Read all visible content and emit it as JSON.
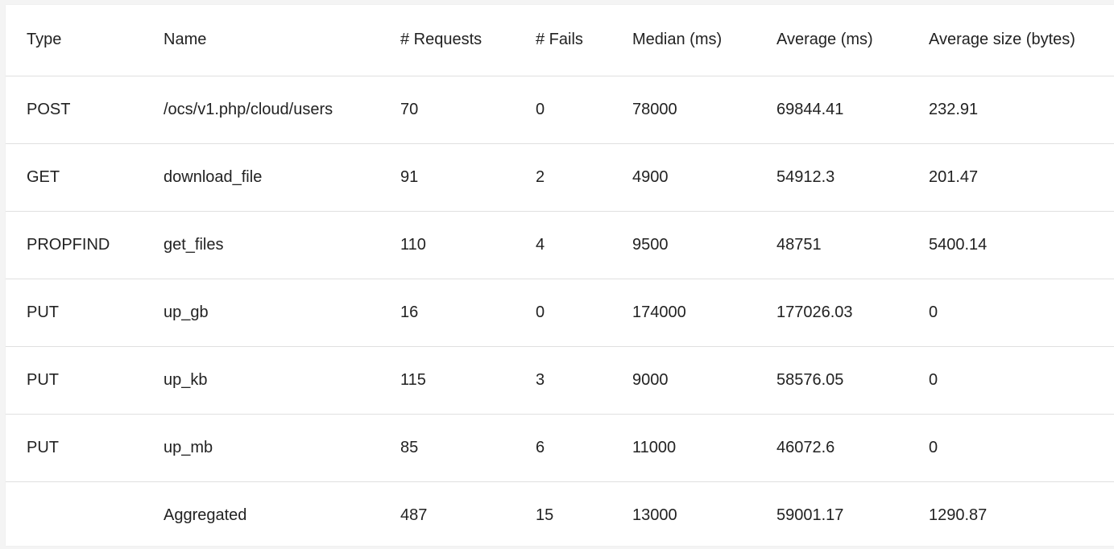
{
  "table": {
    "headers": {
      "type": "Type",
      "name": "Name",
      "requests": "# Requests",
      "fails": "# Fails",
      "median": "Median (ms)",
      "average": "Average (ms)",
      "avg_size": "Average size (bytes)"
    },
    "rows": [
      {
        "type": "POST",
        "name": "/ocs/v1.php/cloud/users",
        "requests": "70",
        "fails": "0",
        "median": "78000",
        "average": "69844.41",
        "avg_size": "232.91"
      },
      {
        "type": "GET",
        "name": "download_file",
        "requests": "91",
        "fails": "2",
        "median": "4900",
        "average": "54912.3",
        "avg_size": "201.47"
      },
      {
        "type": "PROPFIND",
        "name": "get_files",
        "requests": "110",
        "fails": "4",
        "median": "9500",
        "average": "48751",
        "avg_size": "5400.14"
      },
      {
        "type": "PUT",
        "name": "up_gb",
        "requests": "16",
        "fails": "0",
        "median": "174000",
        "average": "177026.03",
        "avg_size": "0"
      },
      {
        "type": "PUT",
        "name": "up_kb",
        "requests": "115",
        "fails": "3",
        "median": "9000",
        "average": "58576.05",
        "avg_size": "0"
      },
      {
        "type": "PUT",
        "name": "up_mb",
        "requests": "85",
        "fails": "6",
        "median": "11000",
        "average": "46072.6",
        "avg_size": "0"
      },
      {
        "type": "",
        "name": "Aggregated",
        "requests": "487",
        "fails": "15",
        "median": "13000",
        "average": "59001.17",
        "avg_size": "1290.87"
      }
    ]
  }
}
